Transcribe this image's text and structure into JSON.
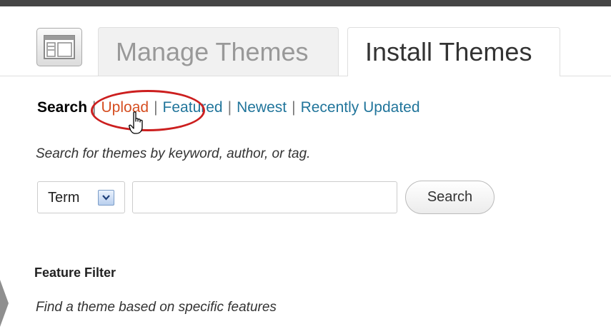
{
  "tabs": {
    "manage": "Manage Themes",
    "install": "Install Themes"
  },
  "subnav": {
    "current": "Search",
    "links": [
      "Upload",
      "Featured",
      "Newest",
      "Recently Updated"
    ],
    "separator": "|"
  },
  "search": {
    "help_text": "Search for themes by keyword, author, or tag.",
    "type_select": "Term",
    "input_value": "",
    "button_label": "Search"
  },
  "feature_filter": {
    "title": "Feature Filter",
    "description": "Find a theme based on specific features"
  },
  "icons": {
    "tab_icon": "appearance-icon",
    "cursor": "hand-pointer-icon",
    "dropdown": "chevron-down-icon",
    "side_arrow": "triangle-left-icon"
  },
  "colors": {
    "link": "#21759b",
    "link_hover": "#d54e21",
    "highlight_ellipse": "#cc1f1f",
    "admin_bar": "#464646"
  }
}
